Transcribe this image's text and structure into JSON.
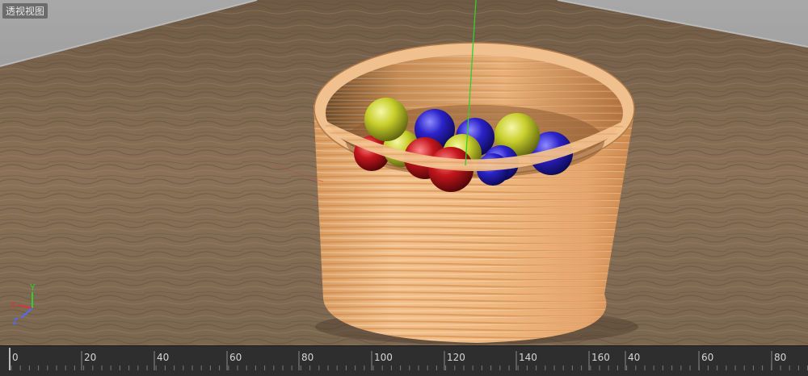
{
  "viewport": {
    "view_label": "透视视图",
    "axis_gizmo": {
      "y_label": "Y",
      "x_label": "X",
      "z_label": "Z"
    }
  },
  "scene": {
    "objects": [
      "wooden-floor",
      "wooden-bucket",
      "spheres"
    ],
    "sphere_colors": {
      "yellow": "#c9d12a",
      "blue": "#2b22c9",
      "red": "#c4161c"
    }
  },
  "timeline": {
    "frames": [
      "0",
      "20",
      "40",
      "60",
      "80",
      "100",
      "120",
      "140",
      "160",
      "40",
      "60",
      "80"
    ]
  }
}
